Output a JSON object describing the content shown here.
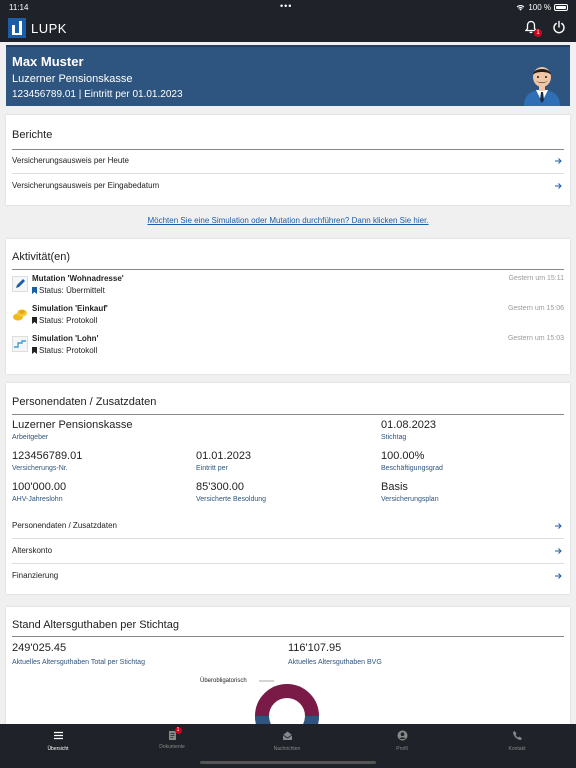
{
  "status": {
    "time": "11:14",
    "dots": "•••",
    "battery": "100 %"
  },
  "app": {
    "title": "LUPK",
    "notification_count": "1"
  },
  "hero": {
    "name": "Max Muster",
    "org": "Luzerner Pensionskasse",
    "ids": "123456789.01 | Eintritt per 01.01.2023"
  },
  "berichte": {
    "title": "Berichte",
    "items": [
      "Versicherungsausweis per Heute",
      "Versicherungsausweis per Eingabedatum"
    ]
  },
  "cta": "Möchten Sie eine Simulation oder Mutation durchführen? Dann klicken Sie hier.",
  "activities": {
    "title": "Aktivität(en)",
    "items": [
      {
        "title": "Mutation 'Wohnadresse'",
        "status": "Status: Übermittelt",
        "when": "Gestern um 15:11",
        "icon": "pencil-icon",
        "bookmark_color": "#1a5ea8"
      },
      {
        "title": "Simulation 'Einkauf'",
        "status": "Status: Protokoll",
        "when": "Gestern um 15:06",
        "icon": "coins-icon",
        "bookmark_color": "#222222"
      },
      {
        "title": "Simulation 'Lohn'",
        "status": "Status: Protokoll",
        "when": "Gestern um 15:03",
        "icon": "salary-chart-icon",
        "bookmark_color": "#222222"
      }
    ]
  },
  "personal": {
    "title": "Personendaten / Zusatzdaten",
    "fields": [
      {
        "value": "Luzerner Pensionskasse",
        "label": "Arbeitgeber"
      },
      {
        "value": "01.08.2023",
        "label": "Stichtag"
      },
      {
        "value": "123456789.01",
        "label": "Versicherungs-Nr."
      },
      {
        "value": "01.01.2023",
        "label": "Eintritt per"
      },
      {
        "value": "100.00%",
        "label": "Beschäftigungsgrad"
      },
      {
        "value": "100'000.00",
        "label": "AHV-Jahreslohn"
      },
      {
        "value": "85'300.00",
        "label": "Versicherte Besoldung"
      },
      {
        "value": "Basis",
        "label": "Versicherungsplan"
      }
    ],
    "links": [
      "Personendaten / Zusatzdaten",
      "Alterskonto",
      "Finanzierung"
    ]
  },
  "guthaben": {
    "title": "Stand Altersguthaben per Stichtag",
    "total_value": "249'025.45",
    "total_label": "Aktuelles Altersguthaben Total per Stichtag",
    "bvg_value": "116'107.95",
    "bvg_label": "Aktuelles Altersguthaben BVG",
    "donut_label": "Überobligatorisch",
    "colors": {
      "ueberobligatorisch": "#7a1a46",
      "bvg": "#2e557f"
    }
  },
  "nav": {
    "items": [
      {
        "label": "Übersicht",
        "icon": "menu-icon"
      },
      {
        "label": "Dokumente",
        "icon": "document-icon",
        "badge": "1"
      },
      {
        "label": "Nachrichten",
        "icon": "mail-icon"
      },
      {
        "label": "Profil",
        "icon": "profile-icon"
      },
      {
        "label": "Kontakt",
        "icon": "phone-icon"
      }
    ]
  }
}
